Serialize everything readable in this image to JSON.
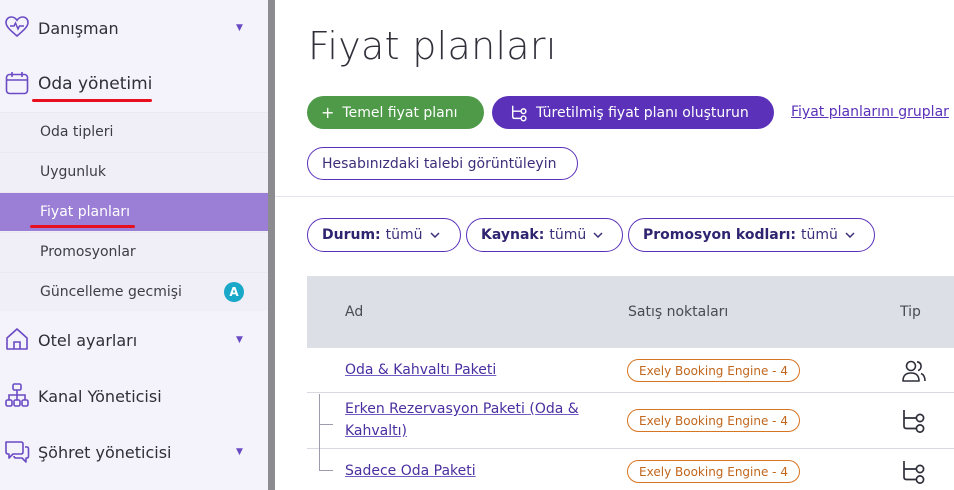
{
  "sidebar": {
    "items": [
      {
        "label": "Danışman",
        "icon": "heart-pulse-icon",
        "has_chevron": true
      },
      {
        "label": "Oda yönetimi",
        "icon": "calendar-icon",
        "has_chevron": false
      },
      {
        "label": "Otel ayarları",
        "icon": "house-icon",
        "has_chevron": true
      },
      {
        "label": "Kanal Yöneticisi",
        "icon": "sitemap-icon",
        "has_chevron": false
      },
      {
        "label": "Şöhret yöneticisi",
        "icon": "chat-bubbles-icon",
        "has_chevron": true
      }
    ],
    "sub_items": [
      {
        "label": "Oda tipleri",
        "active": false
      },
      {
        "label": "Uygunluk",
        "active": false
      },
      {
        "label": "Fiyat planları",
        "active": true
      },
      {
        "label": "Promosyonlar",
        "active": false
      },
      {
        "label": "Güncelleme gecmişi",
        "active": false,
        "badge": "A"
      }
    ],
    "chevron_glyph": "▼"
  },
  "main": {
    "title": "Fiyat planları",
    "buttons": {
      "basic_plan": "Temel fiyat planı",
      "basic_plan_glyph": "+",
      "derived_plan": "Türetilmiş fiyat planı oluşturun",
      "view_request": "Hesabınızdaki talebi görüntüleyin"
    },
    "group_link": "Fiyat planlarını gruplar",
    "filters": [
      {
        "label": "Durum:",
        "value": "tümü"
      },
      {
        "label": "Kaynak:",
        "value": "tümü"
      },
      {
        "label": "Promosyon kodları:",
        "value": "tümü"
      }
    ],
    "caret_glyph": "⌄",
    "table": {
      "columns": [
        "Ad",
        "Satış noktaları",
        "Tip"
      ],
      "rows": [
        {
          "name": "Oda & Kahvaltı Paketi",
          "channel": "Exely Booking Engine - 4",
          "type_icon": "users-icon"
        },
        {
          "name_line1": "Erken Rezervasyon Paketi (Oda &",
          "name_line2": "Kahvaltı)",
          "channel": "Exely Booking Engine - 4",
          "type_icon": "derived-plan-icon"
        },
        {
          "name": "Sadece Oda Paketi",
          "channel": "Exely Booking Engine - 4",
          "type_icon": "derived-plan-icon"
        }
      ]
    }
  },
  "colors": {
    "accent": "#5a31b8",
    "green": "#4e9a48",
    "active_nav": "#9b7ed6",
    "channel_badge": "#d87523",
    "annotation_red": "#e8101e"
  }
}
